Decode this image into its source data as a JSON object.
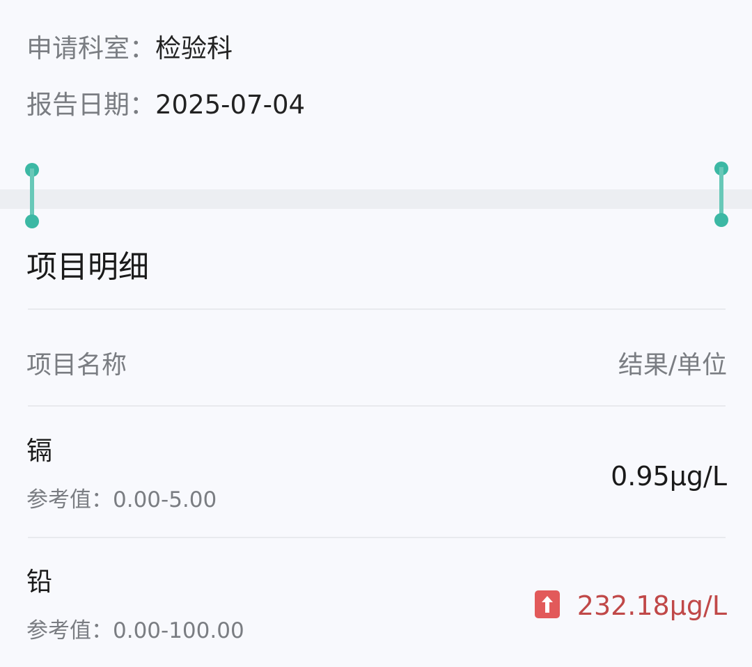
{
  "header": {
    "department_label": "申请科室：",
    "department_value": "检验科",
    "date_label": "报告日期：",
    "date_value": "2025-07-04"
  },
  "section": {
    "title": "项目明细"
  },
  "table": {
    "columns": {
      "name": "项目名称",
      "result": "结果/单位"
    },
    "items": [
      {
        "name": "镉",
        "reference": "参考值：0.00-5.00",
        "result": "0.95μg/L",
        "flag": "normal"
      },
      {
        "name": "铅",
        "reference": "参考值：0.00-100.00",
        "result": "232.18μg/L",
        "flag": "high"
      }
    ]
  },
  "icons": {
    "handle": "selection-handle-icon",
    "up_arrow": "up-arrow-icon"
  },
  "colors": {
    "accent": "#3cb8a4",
    "abnormal_text": "#c04848",
    "abnormal_badge": "#e25a5a"
  }
}
